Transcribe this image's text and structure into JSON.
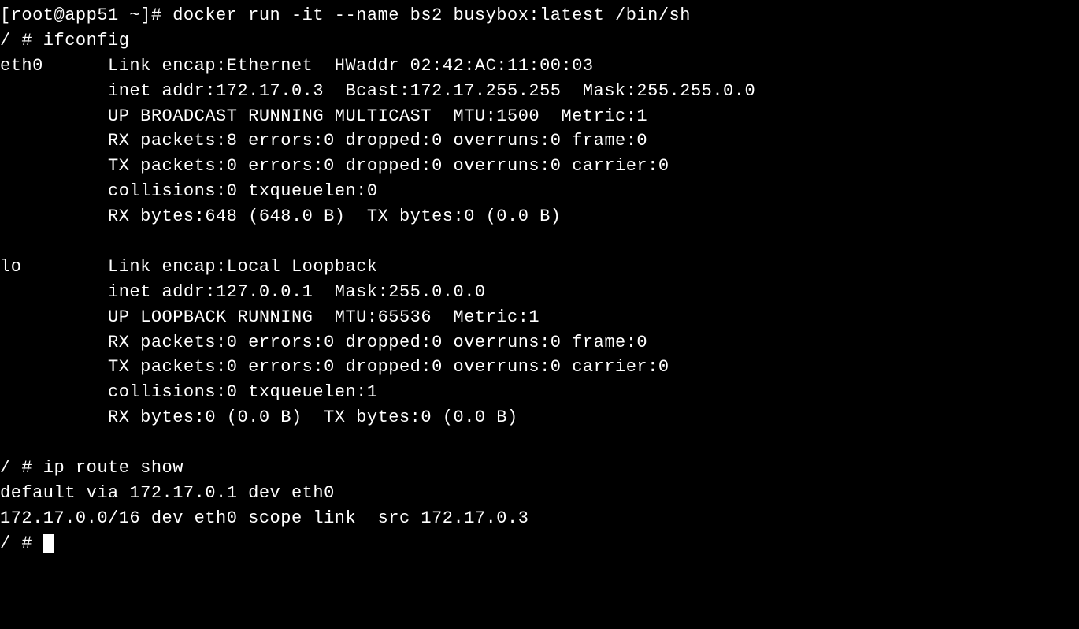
{
  "lines": {
    "l0": "[root@app51 ~]# docker run -it --name bs2 busybox:latest /bin/sh",
    "l1": "/ # ifconfig",
    "l2": "eth0      Link encap:Ethernet  HWaddr 02:42:AC:11:00:03",
    "l3": "          inet addr:172.17.0.3  Bcast:172.17.255.255  Mask:255.255.0.0",
    "l4": "          UP BROADCAST RUNNING MULTICAST  MTU:1500  Metric:1",
    "l5": "          RX packets:8 errors:0 dropped:0 overruns:0 frame:0",
    "l6": "          TX packets:0 errors:0 dropped:0 overruns:0 carrier:0",
    "l7": "          collisions:0 txqueuelen:0",
    "l8": "          RX bytes:648 (648.0 B)  TX bytes:0 (0.0 B)",
    "l9": "",
    "l10": "lo        Link encap:Local Loopback",
    "l11": "          inet addr:127.0.0.1  Mask:255.0.0.0",
    "l12": "          UP LOOPBACK RUNNING  MTU:65536  Metric:1",
    "l13": "          RX packets:0 errors:0 dropped:0 overruns:0 frame:0",
    "l14": "          TX packets:0 errors:0 dropped:0 overruns:0 carrier:0",
    "l15": "          collisions:0 txqueuelen:1",
    "l16": "          RX bytes:0 (0.0 B)  TX bytes:0 (0.0 B)",
    "l17": "",
    "l18": "/ # ip route show",
    "l19": "default via 172.17.0.1 dev eth0",
    "l20": "172.17.0.0/16 dev eth0 scope link  src 172.17.0.3",
    "l21": "/ # "
  }
}
